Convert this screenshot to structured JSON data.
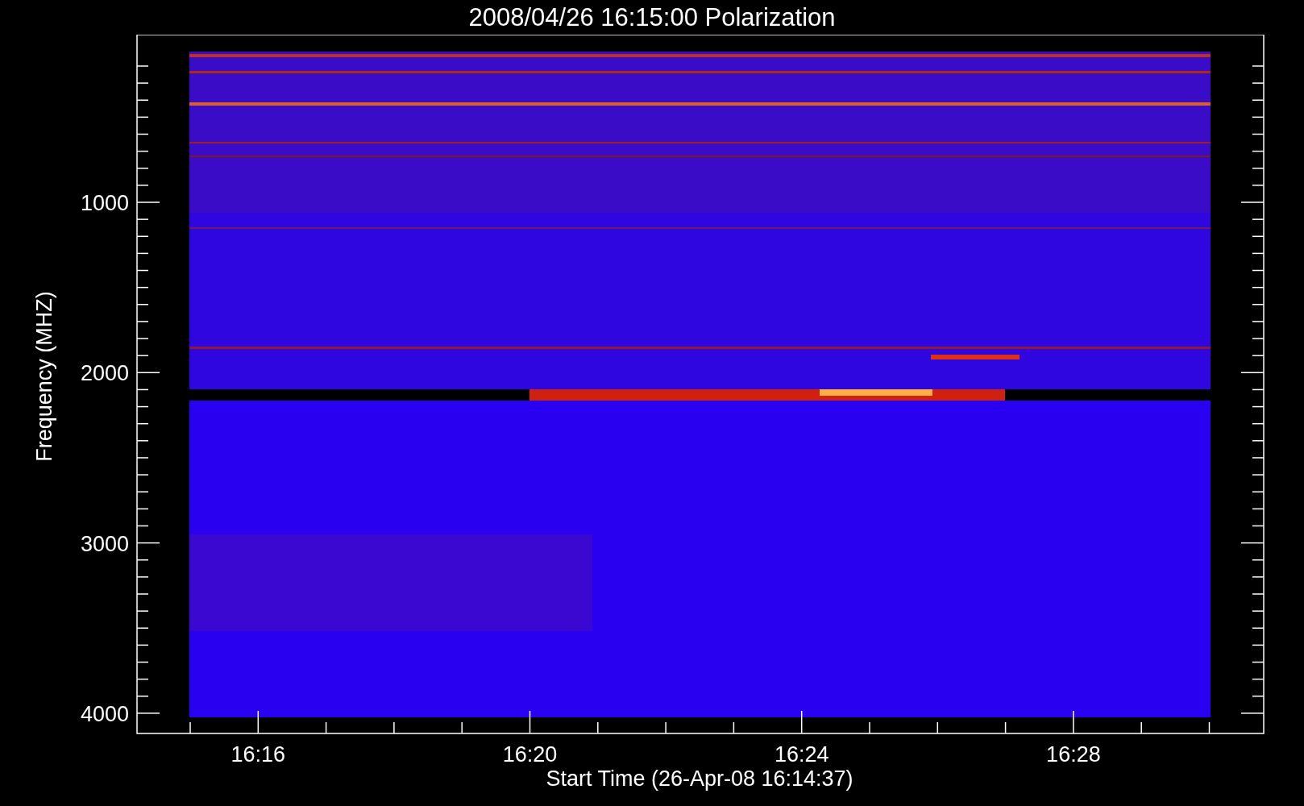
{
  "title": "2008/04/26 16:15:00 Polarization",
  "y_axis": {
    "label": "Frequency (MHZ)",
    "ticks": [
      "1000",
      "2000",
      "3000",
      "4000"
    ]
  },
  "x_axis": {
    "label": "Start Time (26-Apr-08 16:14:37)",
    "ticks": [
      "16:16",
      "16:20",
      "16:24",
      "16:28"
    ]
  }
}
